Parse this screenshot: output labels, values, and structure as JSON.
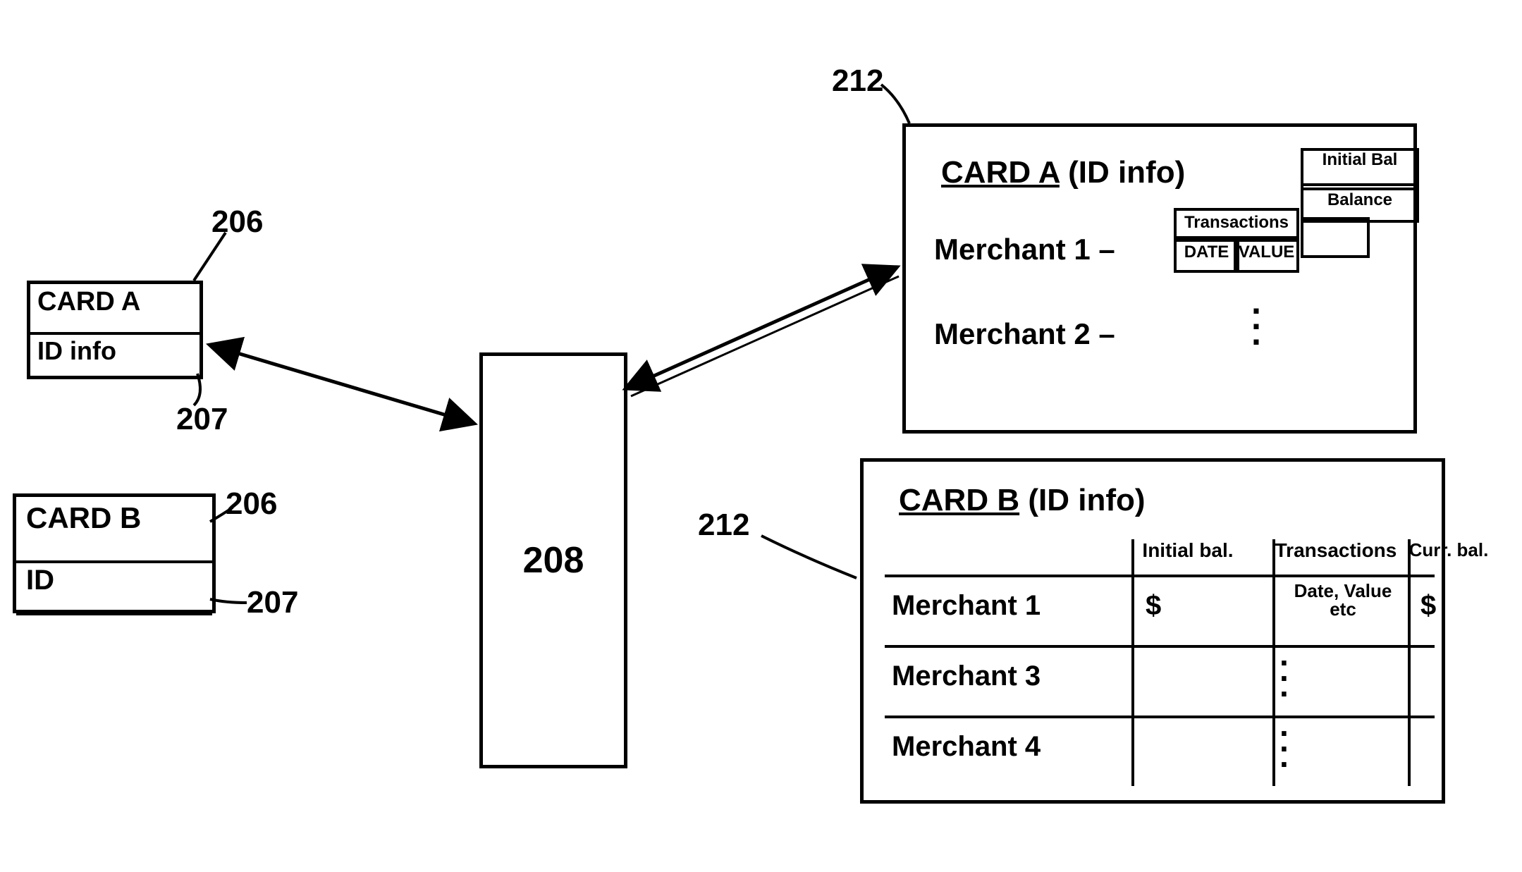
{
  "refs": {
    "r206a": "206",
    "r207a": "207",
    "r206b": "206",
    "r207b": "207",
    "r208": "208",
    "r212a": "212",
    "r212b": "212"
  },
  "cardA": {
    "title": "CARD A",
    "id_label": "ID info"
  },
  "cardB": {
    "title": "CARD B",
    "id_label": "ID"
  },
  "recordA": {
    "title_card": "CARD A",
    "title_id": "(ID info)",
    "merchant1": "Merchant 1 –",
    "merchant2": "Merchant 2 –",
    "hdr_transactions": "Transactions",
    "hdr_date": "DATE",
    "hdr_value": "VALUE",
    "hdr_initial_bal": "Initial Bal",
    "hdr_balance": "Balance"
  },
  "recordB": {
    "title_card": "CARD B",
    "title_id": "(ID info)",
    "hdr_initial_bal": "Initial bal.",
    "hdr_transactions": "Transactions",
    "hdr_curr_bal": "Curr. bal.",
    "rows": [
      {
        "name": "Merchant 1",
        "ib": "$",
        "tr": "Date, Value etc",
        "cb": "$"
      },
      {
        "name": "Merchant 3",
        "ib": "",
        "tr": "",
        "cb": ""
      },
      {
        "name": "Merchant 4",
        "ib": "",
        "tr": "",
        "cb": ""
      }
    ]
  }
}
